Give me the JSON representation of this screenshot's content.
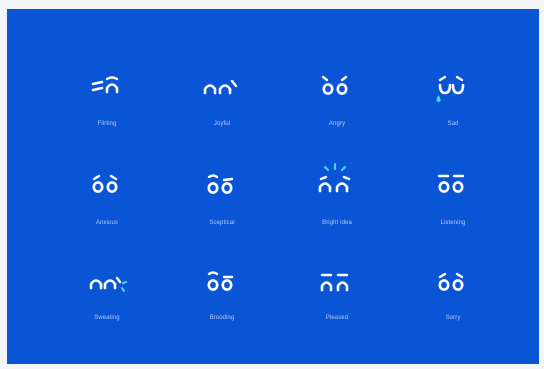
{
  "colors": {
    "background": "#0a55d6",
    "page": "#f4f5f8",
    "stroke": "#ffffff",
    "accent": "#45d4f0",
    "label": "#ebf2ff"
  },
  "expressions": [
    {
      "label": "Flirting",
      "icon": "flirting-face-icon"
    },
    {
      "label": "Joyful",
      "icon": "joyful-face-icon"
    },
    {
      "label": "Angry",
      "icon": "angry-face-icon"
    },
    {
      "label": "Sad",
      "icon": "sad-face-icon"
    },
    {
      "label": "Anxious",
      "icon": "anxious-face-icon"
    },
    {
      "label": "Sceptical",
      "icon": "sceptical-face-icon"
    },
    {
      "label": "Bright idea",
      "icon": "bright-idea-face-icon"
    },
    {
      "label": "Listening",
      "icon": "listening-face-icon"
    },
    {
      "label": "Sweating",
      "icon": "sweating-face-icon"
    },
    {
      "label": "Brooding",
      "icon": "brooding-face-icon"
    },
    {
      "label": "Pleased",
      "icon": "pleased-face-icon"
    },
    {
      "label": "Sorry",
      "icon": "sorry-face-icon"
    }
  ]
}
